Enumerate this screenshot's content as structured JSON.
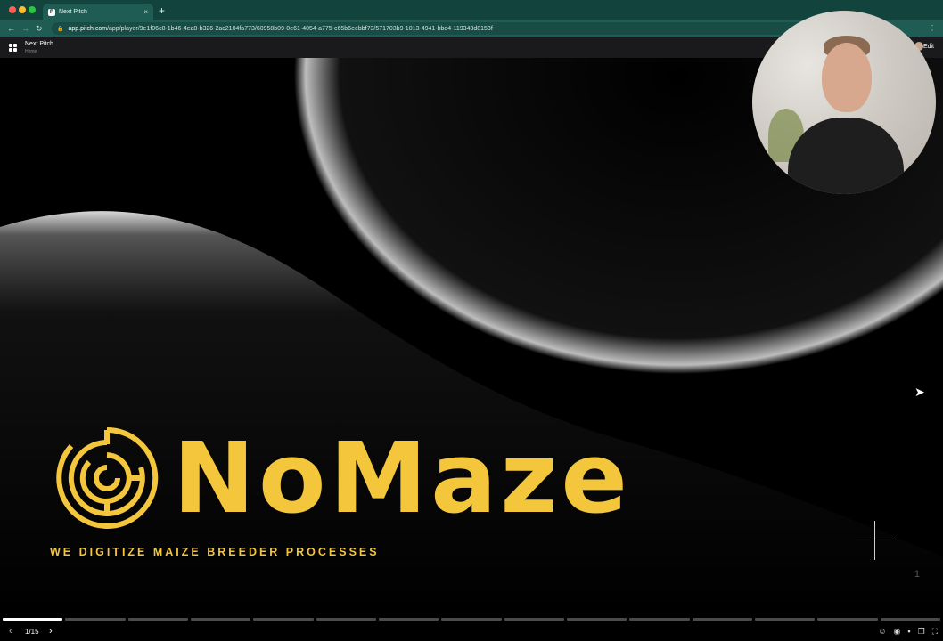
{
  "browser": {
    "tab_title": "Next Pitch",
    "tab_close": "×",
    "new_tab": "+",
    "url_host": "app.pitch.com",
    "url_path": "/app/player/9e1f06c8-1b46-4ea8-b326-2ac2104fa773/60958b09-0e61-4054-a775-c65b6eebbf73/571703b9-1013-4941-bbd4-119343d8153f"
  },
  "app": {
    "doc_title": "Next Pitch",
    "doc_subtitle": "Home",
    "edit_label": "Edit"
  },
  "slide": {
    "wordmark": "NoMaze",
    "tagline": "WE DIGITIZE MAIZE BREEDER PROCESSES",
    "slide_number": "1",
    "brand_color": "#f3c63b"
  },
  "player": {
    "counter": "1/15",
    "total_slides": 15,
    "current_slide": 1
  },
  "colors": {
    "chrome": "#12433d",
    "toolbar": "#1f5c54",
    "accent": "#f3c63b"
  }
}
